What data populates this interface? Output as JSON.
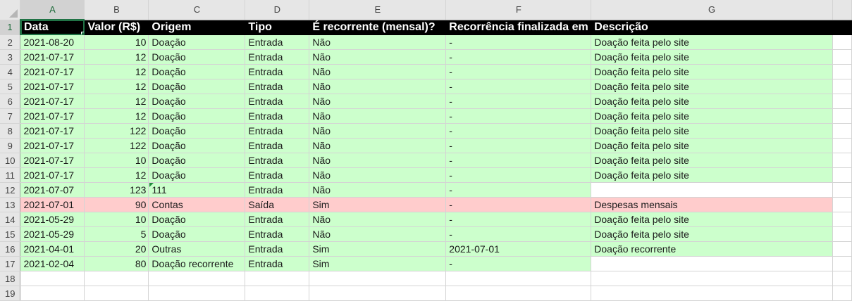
{
  "columns": [
    "A",
    "B",
    "C",
    "D",
    "E",
    "F",
    "G"
  ],
  "row_numbers": [
    "1",
    "2",
    "3",
    "4",
    "5",
    "6",
    "7",
    "8",
    "9",
    "10",
    "11",
    "12",
    "13",
    "14",
    "15",
    "16",
    "17",
    "18",
    "19"
  ],
  "header": [
    "Data",
    "Valor (R$)",
    "Origem",
    "Tipo",
    "É recorrente (mensal)?",
    "Recorrência finalizada em",
    "Descrição"
  ],
  "rows": [
    [
      "2021-08-20",
      "10",
      "Doação",
      "Entrada",
      "Não",
      "-",
      "Doação feita pelo site"
    ],
    [
      "2021-07-17",
      "12",
      "Doação",
      "Entrada",
      "Não",
      "-",
      "Doação feita pelo site"
    ],
    [
      "2021-07-17",
      "12",
      "Doação",
      "Entrada",
      "Não",
      "-",
      "Doação feita pelo site"
    ],
    [
      "2021-07-17",
      "12",
      "Doação",
      "Entrada",
      "Não",
      "-",
      "Doação feita pelo site"
    ],
    [
      "2021-07-17",
      "12",
      "Doação",
      "Entrada",
      "Não",
      "-",
      "Doação feita pelo site"
    ],
    [
      "2021-07-17",
      "12",
      "Doação",
      "Entrada",
      "Não",
      "-",
      "Doação feita pelo site"
    ],
    [
      "2021-07-17",
      "122",
      "Doação",
      "Entrada",
      "Não",
      "-",
      "Doação feita pelo site"
    ],
    [
      "2021-07-17",
      "122",
      "Doação",
      "Entrada",
      "Não",
      "-",
      "Doação feita pelo site"
    ],
    [
      "2021-07-17",
      "10",
      "Doação",
      "Entrada",
      "Não",
      "-",
      "Doação feita pelo site"
    ],
    [
      "2021-07-17",
      "12",
      "Doação",
      "Entrada",
      "Não",
      "-",
      "Doação feita pelo site"
    ],
    [
      "2021-07-07",
      "123",
      "111",
      "Entrada",
      "Não",
      "-",
      ""
    ],
    [
      "2021-07-01",
      "90",
      "Contas",
      "Saída",
      "Sim",
      "-",
      "Despesas mensais"
    ],
    [
      "2021-05-29",
      "10",
      "Doação",
      "Entrada",
      "Não",
      "-",
      "Doação feita pelo site"
    ],
    [
      "2021-05-29",
      "5",
      "Doação",
      "Entrada",
      "Não",
      "-",
      "Doação feita pelo site"
    ],
    [
      "2021-04-01",
      "20",
      "Outras",
      "Entrada",
      "Sim",
      "2021-07-01",
      "Doação recorrente"
    ],
    [
      "2021-02-04",
      "80",
      "Doação recorrente",
      "Entrada",
      "Sim",
      "-",
      ""
    ]
  ],
  "colors": {
    "income_fill": "#ccffcc",
    "expense_fill": "#ffcccc",
    "header_fill": "#000000",
    "selection": "#217346"
  }
}
